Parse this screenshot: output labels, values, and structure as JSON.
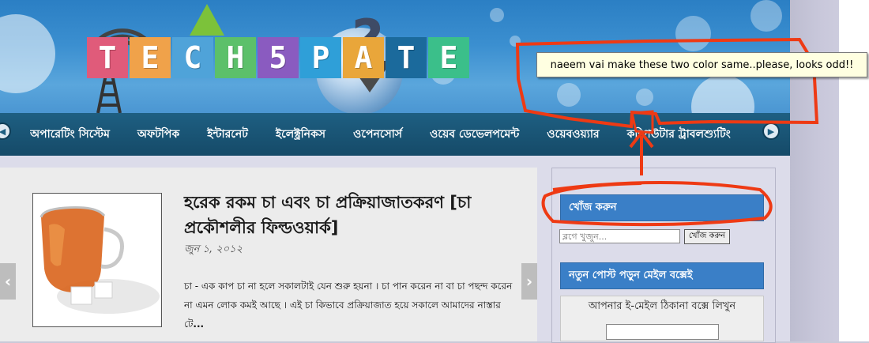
{
  "logo": {
    "letters": [
      "T",
      "E",
      "C",
      "H",
      "5",
      "P",
      "A",
      "T",
      "E"
    ],
    "letter_colors": [
      "#e05b7a",
      "#f0a24a",
      "#4fa3d9",
      "#5cc06a",
      "#8a5bc0",
      "#2f9fd8",
      "#e9a63a",
      "#1b6a9c",
      "#3bbf8a"
    ]
  },
  "annotation": {
    "note_text": "naeem vai make these two color same..please, looks odd!!",
    "color": "#ee3a14"
  },
  "nav": {
    "items": [
      "অপারেটিং সিস্টেম",
      "অফটপিক",
      "ইন্টারনেট",
      "ইলেক্ট্রনিকস",
      "ওপেনসোর্স",
      "ওয়েব ডেভেলপমেন্ট",
      "ওয়েবওয়্যার",
      "কম্পিউটার ট্রাবলশ্যুটিং"
    ],
    "bg_color": "#1a5575"
  },
  "post": {
    "title": "হরেক রকম চা এবং চা প্রক্রিয়াজাতকরণ [চা প্রকৌশলীর ফিল্ডওয়ার্ক]",
    "date": "জুন ১, ২০১২",
    "excerpt": "চা - এক কাপ চা না হলে সকালটাই যেন শুরু হয়না । চা পান করেন না বা চা পছন্দ করেন না এমন লোক কমই আছে । এই চা কিভাবে প্রক্রিয়াজাত হয়ে সকালে আমাদের নাস্তার টে",
    "more": "..."
  },
  "sidebar": {
    "search_heading": "খোঁজ করুন",
    "search_placeholder": "ব্লগে খুজুন...",
    "search_button": "খোঁজ করুন",
    "subscribe_heading": "নতুন পোস্ট পড়ুন মেইল বক্সেই",
    "email_label": "আপনার ই-মেইল ঠিকানা বক্সে লিখুন",
    "heading_color": "#3a7fc7"
  }
}
